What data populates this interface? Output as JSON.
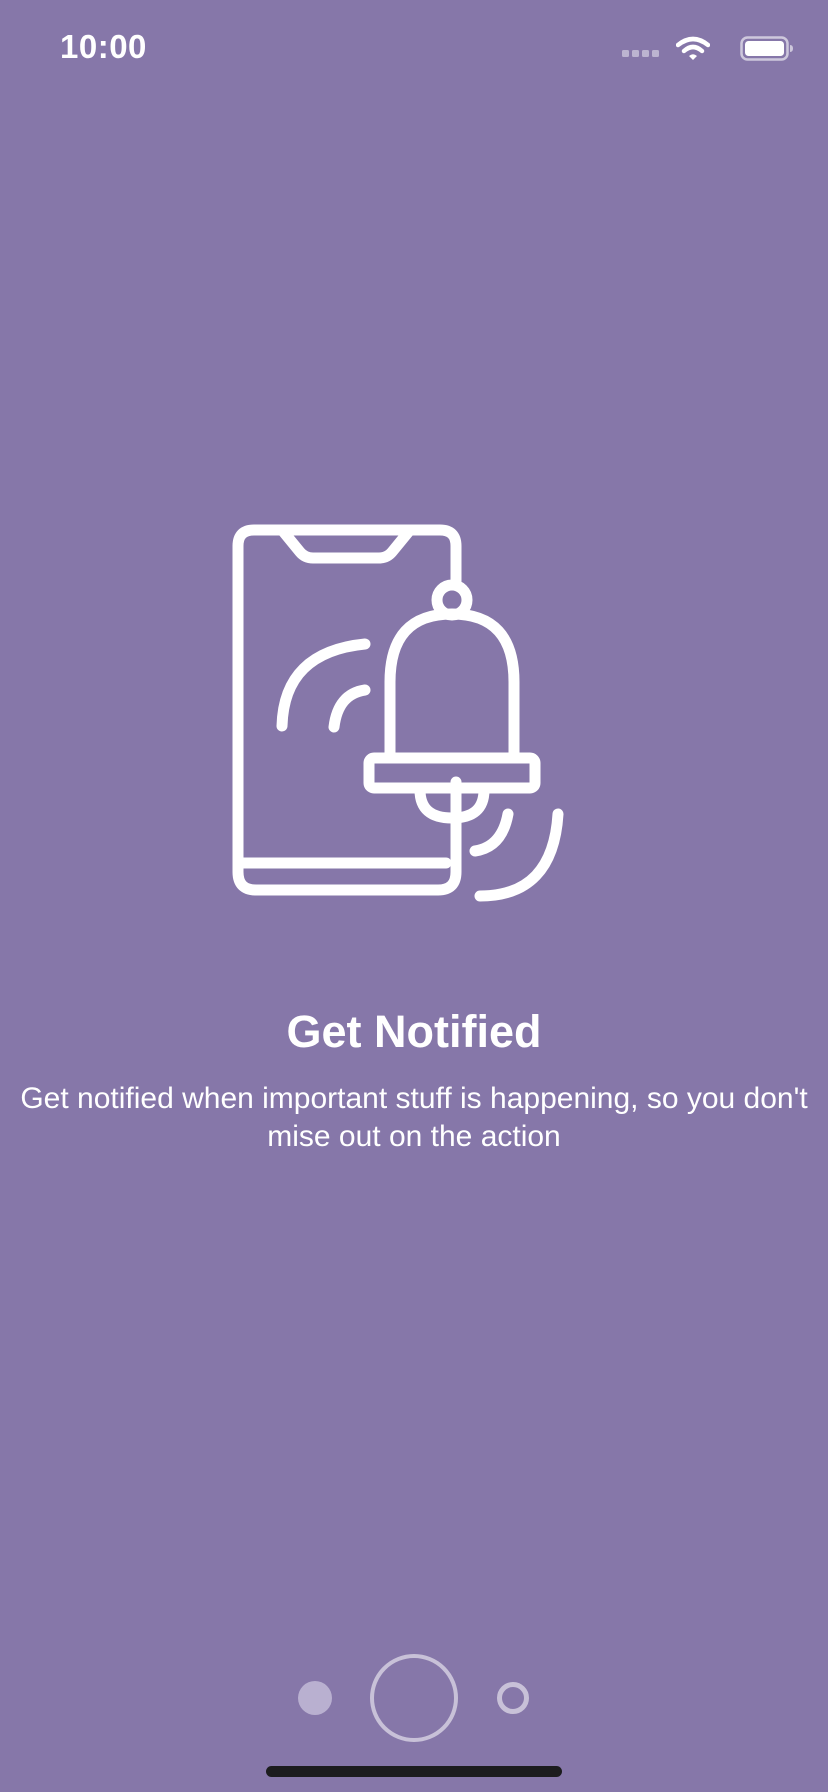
{
  "colors": {
    "background": "#8677A9",
    "foreground": "#FFFFFF",
    "pager_filled_dot": "#B9B0D0",
    "home_indicator": "#1C1C1E"
  },
  "status_bar": {
    "time": "10:00",
    "icons": [
      "cellular-signal-icon",
      "wifi-icon",
      "battery-icon"
    ]
  },
  "onboarding": {
    "illustration": "phone-bell-notification-icon",
    "title": "Get Notified",
    "description": "Get notified when important stuff is happening, so you don't mise out on the action"
  },
  "pager": {
    "page_count": 3,
    "current_page": 2
  }
}
